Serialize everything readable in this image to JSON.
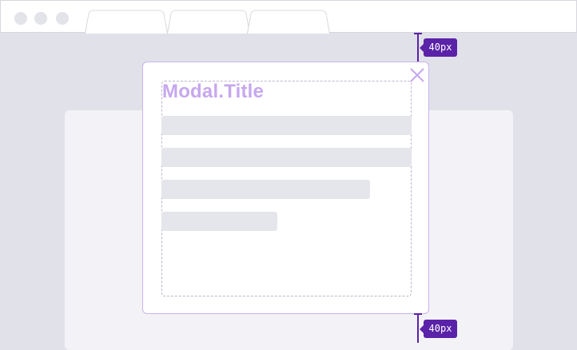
{
  "browser": {
    "tabs": [
      {
        "label": ""
      },
      {
        "label": ""
      },
      {
        "label": ""
      }
    ]
  },
  "modal": {
    "title": "Modal.Title",
    "close_icon": "close-icon"
  },
  "annotations": {
    "top_spacing": "40px",
    "bottom_spacing": "40px"
  },
  "colors": {
    "accent": "#5a22a8",
    "title": "#c6a8ee",
    "modal_border": "#c9b3f0",
    "backdrop": "#e1e1ea",
    "skeleton": "#e5e5ec"
  }
}
